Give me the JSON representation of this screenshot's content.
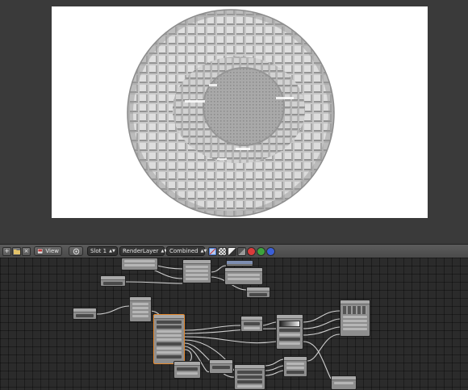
{
  "header": {
    "view_label": "View",
    "slot_label": "Slot 1",
    "render_layer_label": "RenderLayer",
    "pass_label": "Combined",
    "icons": {
      "view_options": "plus-icon",
      "open_image": "folder-icon",
      "close_image": "close-icon",
      "editor_type": "image-editor-icon",
      "pin": "pin-icon",
      "updown": "updown-arrows-icon",
      "draw_alpha": "alpha-checker-icon",
      "draw_z": "z-buffer-icon",
      "channel_red": "red-channel-icon",
      "channel_green": "green-channel-icon",
      "channel_blue": "blue-channel-icon"
    }
  },
  "colors": {
    "background": "#2f2f2f",
    "header": "#4f4f4f",
    "node_body": "#8e8e8e",
    "node_active_border": "#e4882c",
    "wire": "#cfcfcf",
    "red": "#d83b3b",
    "green": "#3da33d",
    "blue": "#3b5fd8"
  }
}
